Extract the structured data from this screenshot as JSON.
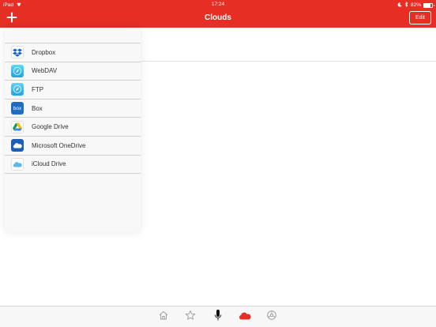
{
  "status_bar": {
    "device": "iPad",
    "time": "17:24",
    "battery_percent": "82%",
    "battery_level": 0.82,
    "wifi_icon": "wifi-icon",
    "moon_icon": "moon-icon",
    "bluetooth_icon": "bluetooth-icon"
  },
  "nav": {
    "title": "Clouds",
    "edit_label": "Edit",
    "add_icon": "plus-icon",
    "accent_color": "#e62e24"
  },
  "menu": {
    "items": [
      {
        "label": "Dropbox",
        "icon": "dropbox-icon"
      },
      {
        "label": "WebDAV",
        "icon": "webdav-icon"
      },
      {
        "label": "FTP",
        "icon": "ftp-icon"
      },
      {
        "label": "Box",
        "icon": "box-icon",
        "icon_text": "box"
      },
      {
        "label": "Google Drive",
        "icon": "google-drive-icon"
      },
      {
        "label": "Microsoft OneDrive",
        "icon": "onedrive-icon"
      },
      {
        "label": "iCloud Drive",
        "icon": "icloud-drive-icon"
      }
    ]
  },
  "tabs": [
    {
      "icon": "home-icon",
      "active": false
    },
    {
      "icon": "star-icon",
      "active": false
    },
    {
      "icon": "microphone-icon",
      "active": false
    },
    {
      "icon": "cloud-icon",
      "active": true
    },
    {
      "icon": "settings-icon",
      "active": false
    }
  ]
}
